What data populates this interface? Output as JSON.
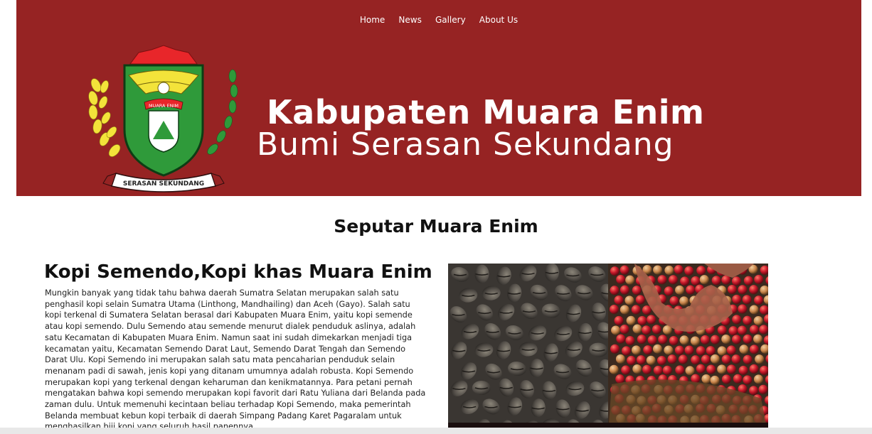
{
  "nav": {
    "items": [
      {
        "label": "Home"
      },
      {
        "label": "News"
      },
      {
        "label": "Gallery"
      },
      {
        "label": "About Us"
      }
    ]
  },
  "banner": {
    "title": "Kabupaten Muara Enim",
    "subtitle": "Bumi Serasan Sekundang",
    "emblem": {
      "top_text": "MUARA ENIM",
      "ribbon_text": "SERASAN SEKUNDANG"
    },
    "colors": {
      "background": "#962323",
      "text": "#ffffff"
    }
  },
  "section": {
    "title": "Seputar Muara Enim"
  },
  "article": {
    "title": "Kopi Semendo,Kopi khas Muara Enim",
    "body": "Mungkin banyak yang tidak tahu bahwa daerah Sumatra Selatan merupakan salah satu penghasil kopi selain Sumatra Utama (Linthong, Mandhailing) dan Aceh (Gayo). Salah satu kopi terkenal di Sumatera Selatan berasal dari Kabupaten Muara Enim, yaitu kopi semende atau kopi semendo. Dulu Semendo atau semende menurut dialek penduduk aslinya, adalah satu Kecamatan di Kabupaten Muara Enim. Namun saat ini sudah dimekarkan menjadi tiga kecamatan yaitu, Kecamatan Semendo Darat Laut, Semendo Darat Tengah dan Semendo Darat Ulu. Kopi Semendo ini merupakan salah satu mata pencaharian penduduk selain menanam padi di sawah, jenis kopi yang ditanam umumnya adalah robusta. Kopi Semendo merupakan kopi yang terkenal dengan keharuman dan kenikmatannya. Para petani pernah mengatakan bahwa kopi semendo merupakan kopi favorit dari Ratu Yuliana dari Belanda pada zaman dulu. Untuk memenuhi kecintaan beliau terhadap Kopi Semendo, maka pemerintah Belanda membuat kebun kopi terbaik di daerah Simpang Padang Karet Pagaralam untuk menghasilkan biji kopi yang seluruh hasil panennya",
    "image": {
      "left": "roasted-coffee-beans",
      "right": "red-coffee-cherries-in-hands"
    }
  }
}
